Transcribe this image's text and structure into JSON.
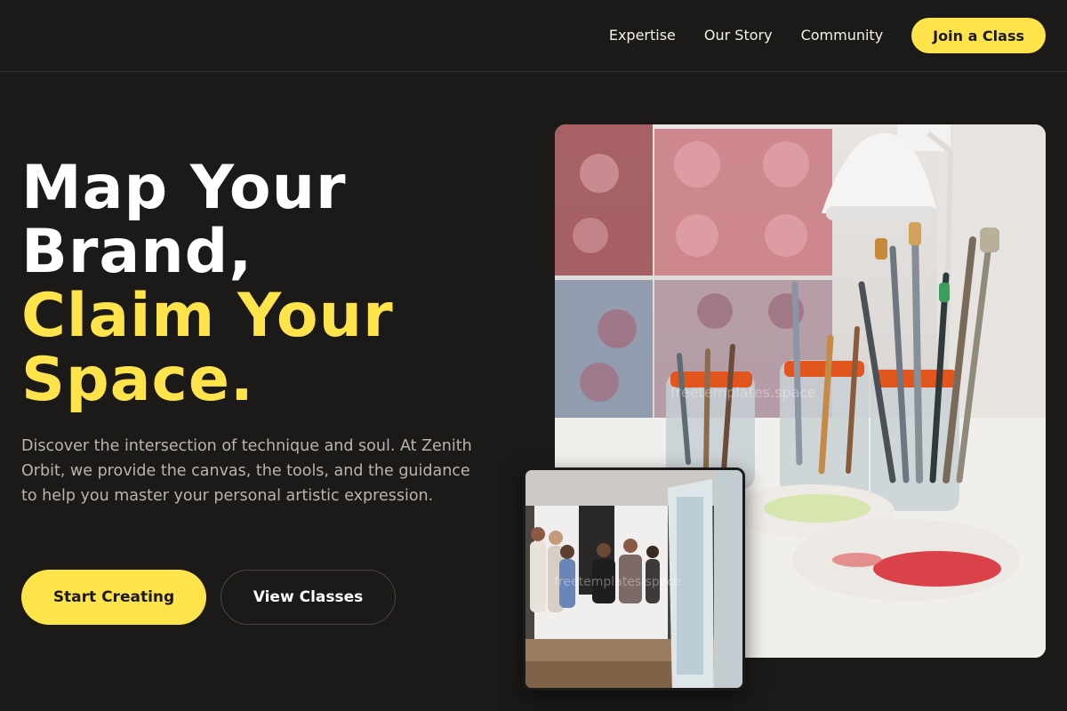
{
  "header": {
    "nav": [
      {
        "label": "Expertise"
      },
      {
        "label": "Our Story"
      },
      {
        "label": "Community"
      }
    ],
    "cta_label": "Join a Class"
  },
  "hero": {
    "title_lines": [
      "Map Your",
      "Brand,"
    ],
    "accent_lines": [
      "Claim Your",
      "Space."
    ],
    "subtitle": "Discover the intersection of technique and soul. At Zenith Orbit, we provide the canvas, the tools, and the guidance to help you master your personal artistic expression.",
    "primary_button": "Start Creating",
    "secondary_button": "View Classes"
  },
  "images": {
    "main_watermark": "freetemplates.space",
    "gallery_watermark": "freetemplates.space"
  },
  "colors": {
    "background": "#1c1a19",
    "accent": "#fee34a",
    "text": "#ffffff",
    "muted_text": "#b9b4ae"
  }
}
